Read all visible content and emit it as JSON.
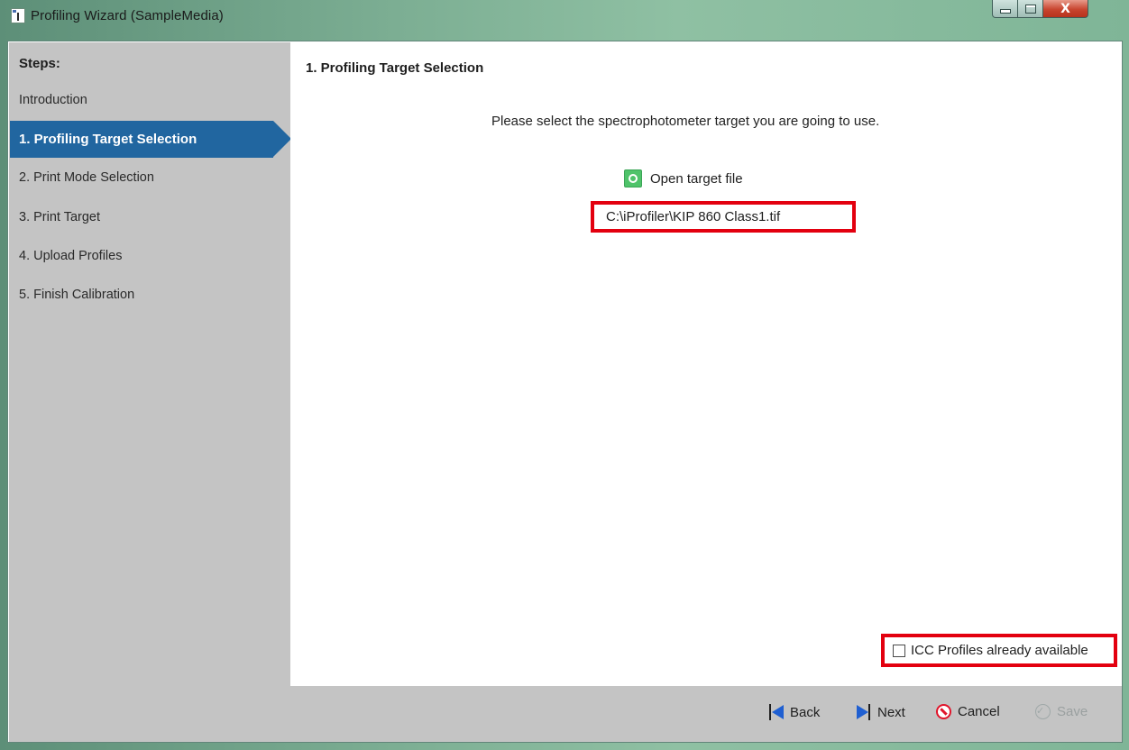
{
  "window": {
    "title": "Profiling Wizard (SampleMedia)",
    "controls": {
      "minimize": "minimize",
      "maximize": "maximize",
      "close": "X"
    }
  },
  "sidebar": {
    "header": "Steps:",
    "items": [
      {
        "label": "Introduction",
        "active": false
      },
      {
        "label": "1. Profiling Target Selection",
        "active": true
      },
      {
        "label": "2. Print Mode Selection",
        "active": false
      },
      {
        "label": "3. Print Target",
        "active": false
      },
      {
        "label": "4. Upload Profiles",
        "active": false
      },
      {
        "label": "5. Finish Calibration",
        "active": false
      }
    ]
  },
  "main": {
    "section_title": "1. Profiling Target Selection",
    "prompt": "Please select the spectrophotometer target you are going to use.",
    "open_target_label": "Open target file",
    "target_path": "C:\\iProfiler\\KIP 860 Class1.tif",
    "icc_checkbox_label": "ICC Profiles already available",
    "icc_checked": false
  },
  "footer": {
    "back_label": "Back",
    "next_label": "Next",
    "cancel_label": "Cancel",
    "save_label": "Save",
    "save_enabled": false
  },
  "colors": {
    "active_step": "#2166a0",
    "highlight_border": "#e3000f",
    "open_icon": "#4fc36a"
  }
}
